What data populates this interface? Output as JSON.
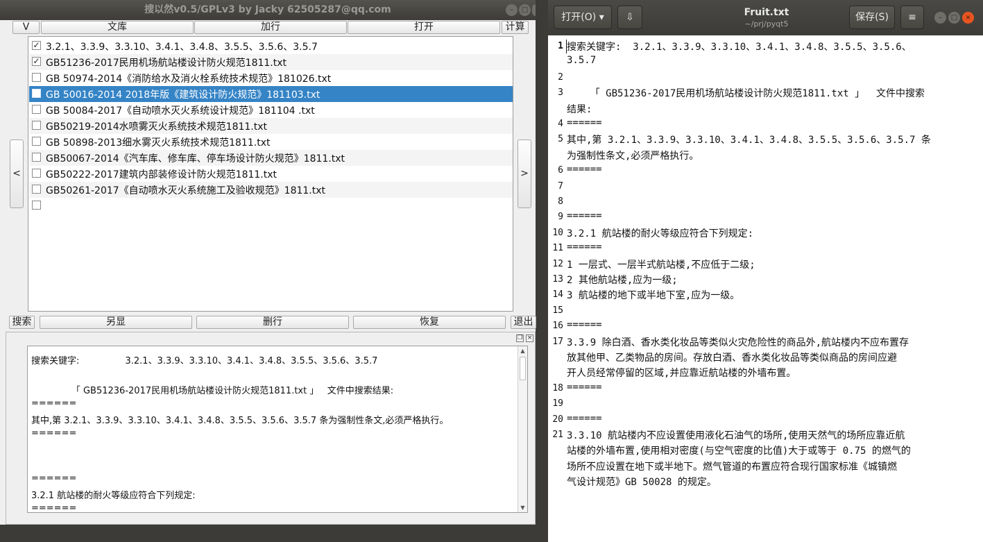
{
  "left_window": {
    "title": "搜以然v0.5/GPLv3 by Jacky 62505287@qq.com",
    "controls": {
      "minimize": "–",
      "maximize": "□",
      "close": "×"
    },
    "top_buttons": {
      "v": "V",
      "library": "文库",
      "add_line": "加行",
      "open": "打开",
      "calc": "计算"
    },
    "file_list": [
      {
        "label": "3.2.1、3.3.9、3.3.10、3.4.1、3.4.8、3.5.5、3.5.6、3.5.7",
        "checked": true,
        "selected": false
      },
      {
        "label": "GB51236-2017民用机场航站楼设计防火规范1811.txt",
        "checked": true,
        "selected": false
      },
      {
        "label": "GB 50974-2014《消防给水及消火栓系统技术规范》181026.txt",
        "checked": false,
        "selected": false
      },
      {
        "label": "GB 50016-2014  2018年版《建筑设计防火规范》181103.txt",
        "checked": false,
        "selected": true
      },
      {
        "label": "GB 50084-2017《自动喷水灭火系统设计规范》181104 .txt",
        "checked": false,
        "selected": false
      },
      {
        "label": "GB50219-2014水喷雾灭火系统技术规范1811.txt",
        "checked": false,
        "selected": false
      },
      {
        "label": "GB 50898-2013细水雾灭火系统技术规范1811.txt",
        "checked": false,
        "selected": false
      },
      {
        "label": "GB50067-2014《汽车库、修车库、停车场设计防火规范》1811.txt",
        "checked": false,
        "selected": false
      },
      {
        "label": "GB50222-2017建筑内部装修设计防火规范1811.txt",
        "checked": false,
        "selected": false
      },
      {
        "label": "GB50261-2017《自动喷水灭火系统施工及验收规范》1811.txt",
        "checked": false,
        "selected": false
      },
      {
        "label": "",
        "checked": false,
        "selected": false
      }
    ],
    "nav": {
      "prev": "<",
      "next": ">"
    },
    "bottom_buttons": {
      "search": "搜索",
      "show_alt": "另显",
      "delete_line": "删行",
      "restore": "恢复",
      "exit": "退出"
    },
    "result_lines": [
      "搜索关键字:                3.2.1、3.3.9、3.3.10、3.4.1、3.4.8、3.5.5、3.5.6、3.5.7",
      "",
      "              「 GB51236-2017民用机场航站楼设计防火规范1811.txt 」   文件中搜索结果:",
      "======",
      "其中,第 3.2.1、3.3.9、3.3.10、3.4.1、3.4.8、3.5.5、3.5.6、3.5.7 条为强制性条文,必须严格执行。",
      "======",
      "",
      "",
      "======",
      "3.2.1 航站楼的耐火等级应符合下列规定:",
      "======"
    ],
    "scroll": {
      "up": "▲",
      "down": "▼"
    }
  },
  "gedit": {
    "open_label": "打开(O)",
    "open_arrow": "▾",
    "pin_icon": "⇩",
    "title": "Fruit.txt",
    "path": "~/prj/pyqt5",
    "save_label": "保存(S)",
    "menu_icon": "≡",
    "lines": [
      {
        "n": "1",
        "text": [
          "搜索关键字:  3.2.1、3.3.9、3.3.10、3.4.1、3.4.8、3.5.5、3.5.6、",
          "3.5.7"
        ]
      },
      {
        "n": "2",
        "text": [
          ""
        ]
      },
      {
        "n": "3",
        "text": [
          "    「 GB51236-2017民用机场航站楼设计防火规范1811.txt 」  文件中搜索",
          "结果:"
        ]
      },
      {
        "n": "4",
        "text": [
          "======"
        ]
      },
      {
        "n": "5",
        "text": [
          "其中,第 3.2.1、3.3.9、3.3.10、3.4.1、3.4.8、3.5.5、3.5.6、3.5.7 条",
          "为强制性条文,必须严格执行。"
        ]
      },
      {
        "n": "6",
        "text": [
          "======"
        ]
      },
      {
        "n": "7",
        "text": [
          ""
        ]
      },
      {
        "n": "8",
        "text": [
          ""
        ]
      },
      {
        "n": "9",
        "text": [
          "======"
        ]
      },
      {
        "n": "10",
        "text": [
          "3.2.1 航站楼的耐火等级应符合下列规定:"
        ]
      },
      {
        "n": "11",
        "text": [
          "======"
        ]
      },
      {
        "n": "12",
        "text": [
          "1 一层式、一层半式航站楼,不应低于二级;"
        ]
      },
      {
        "n": "13",
        "text": [
          "2 其他航站楼,应为一级;"
        ]
      },
      {
        "n": "14",
        "text": [
          "3 航站楼的地下或半地下室,应为一级。"
        ]
      },
      {
        "n": "15",
        "text": [
          ""
        ]
      },
      {
        "n": "16",
        "text": [
          "======"
        ]
      },
      {
        "n": "17",
        "text": [
          "3.3.9 除白酒、香水类化妆品等类似火灾危险性的商品外,航站楼内不应布置存",
          "放其他甲、乙类物品的房间。存放白酒、香水类化妆品等类似商品的房间应避",
          "开人员经常停留的区域,并应靠近航站楼的外墙布置。"
        ]
      },
      {
        "n": "18",
        "text": [
          "======"
        ]
      },
      {
        "n": "19",
        "text": [
          ""
        ]
      },
      {
        "n": "20",
        "text": [
          "======"
        ]
      },
      {
        "n": "21",
        "text": [
          "3.3.10 航站楼内不应设置使用液化石油气的场所,使用天然气的场所应靠近航",
          "站楼的外墙布置,使用相对密度(与空气密度的比值)大于或等于 0.75 的燃气的",
          "场所不应设置在地下或半地下。燃气管道的布置应符合现行国家标准《城镇燃",
          "气设计规范》GB 50028 的规定。"
        ]
      }
    ]
  }
}
